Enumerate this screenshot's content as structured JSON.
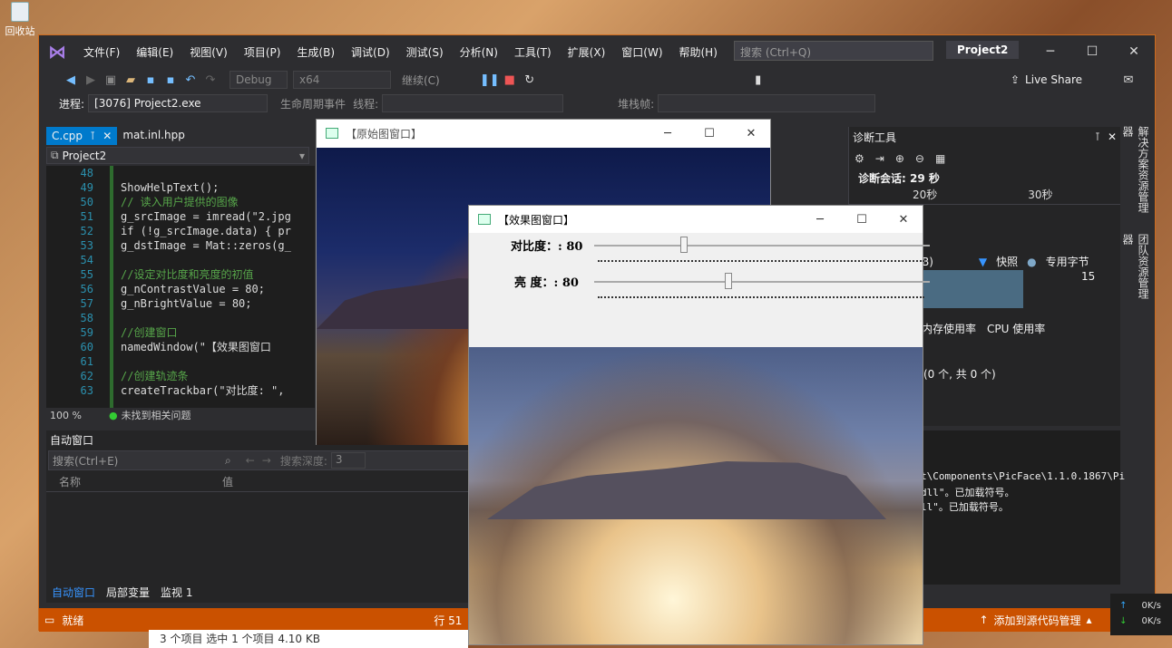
{
  "desktop": {
    "recycle_label": "回收站"
  },
  "vs": {
    "menu": [
      "文件(F)",
      "编辑(E)",
      "视图(V)",
      "项目(P)",
      "生成(B)",
      "调试(D)",
      "测试(S)",
      "分析(N)",
      "工具(T)",
      "扩展(X)",
      "窗口(W)",
      "帮助(H)"
    ],
    "search_placeholder": "搜索 (Ctrl+Q)",
    "project_badge": "Project2",
    "live_share": "Live Share",
    "toolbar": {
      "config": "Debug",
      "platform": "x64",
      "continue": "继续(C)"
    },
    "process": {
      "label": "进程:",
      "value": "[3076] Project2.exe",
      "lifecycle": "生命周期事件",
      "thread": "线程:",
      "stackframe": "堆栈帧:"
    },
    "tabs": [
      {
        "label": "C.cpp",
        "active": true
      },
      {
        "label": "mat.inl.hpp",
        "active": false
      }
    ],
    "nav_project": "Project2",
    "code_lines": [
      {
        "n": "48",
        "t": ""
      },
      {
        "n": "49",
        "t": "ShowHelpText();"
      },
      {
        "n": "50",
        "t": "// 读入用户提供的图像",
        "comment": true
      },
      {
        "n": "51",
        "t": "g_srcImage = imread(\"2.jpg"
      },
      {
        "n": "52",
        "t": "if (!g_srcImage.data) { pr"
      },
      {
        "n": "53",
        "t": "g_dstImage = Mat::zeros(g_"
      },
      {
        "n": "54",
        "t": ""
      },
      {
        "n": "55",
        "t": "//设定对比度和亮度的初值",
        "comment": true
      },
      {
        "n": "56",
        "t": "g_nContrastValue = 80;"
      },
      {
        "n": "57",
        "t": "g_nBrightValue = 80;"
      },
      {
        "n": "58",
        "t": ""
      },
      {
        "n": "59",
        "t": "//创建窗口",
        "comment": true
      },
      {
        "n": "60",
        "t": "namedWindow(\"【效果图窗口"
      },
      {
        "n": "61",
        "t": ""
      },
      {
        "n": "62",
        "t": "//创建轨迹条",
        "comment": true
      },
      {
        "n": "63",
        "t": "createTrackbar(\"对比度: \","
      }
    ],
    "zoom": "100 %",
    "issues": "未找到相关问题",
    "autos": {
      "title": "自动窗口",
      "search": "搜索(Ctrl+E)",
      "depth_label": "搜索深度:",
      "depth_value": "3",
      "col_name": "名称",
      "col_value": "值"
    },
    "bottom_tabs": [
      "自动窗口",
      "局部变量",
      "监视 1"
    ],
    "diag": {
      "title": "诊断工具",
      "session": "诊断会话: 29 秒",
      "t20": "20秒",
      "t30": "30秒",
      "mem_suffix": "B)",
      "snapshot": "快照",
      "private_bytes": "专用字节",
      "value15": "15",
      "mem_usage": "内存使用率",
      "cpu_usage": "CPU 使用率",
      "events": "(0 个, 共 0 个)"
    },
    "output_lines": [
      "t\\Components\\PicFace\\1.1.0.1867\\Pi",
      "dll\"。已加载符号。",
      "ll\"。已加载符号。"
    ],
    "side_tabs": [
      "解决方案资源管理器",
      "团队资源管理器"
    ],
    "status": {
      "ready": "就绪",
      "line": "行 51",
      "source_control": "添加到源代码管理"
    }
  },
  "cv_original": {
    "title": "【原始图窗口】"
  },
  "cv_effect": {
    "title": "【效果图窗口】",
    "contrast": {
      "label": "对比度：: 80",
      "value": 80,
      "max": 300
    },
    "brightness": {
      "label": "亮  度：: 80",
      "value": 80,
      "max": 200
    }
  },
  "taskbar": {
    "fragment": "3 个项目   选中 1 个项目  4.10 KB"
  },
  "net": {
    "up": "0K/s",
    "down": "0K/s"
  }
}
